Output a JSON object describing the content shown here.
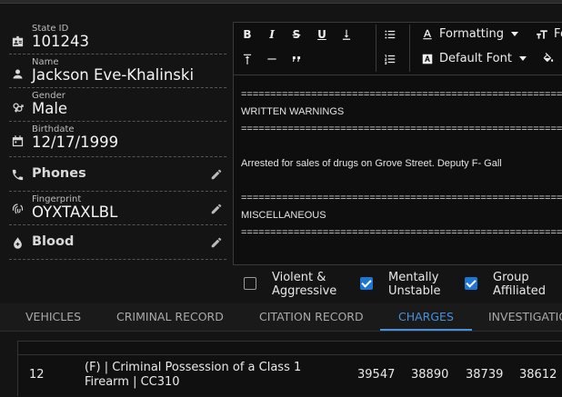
{
  "profile": {
    "state_id": {
      "label": "State ID",
      "value": "101243"
    },
    "name": {
      "label": "Name",
      "value": "Jackson Eve-Khalinski"
    },
    "gender": {
      "label": "Gender",
      "value": "Male"
    },
    "birthdate": {
      "label": "Birthdate",
      "value": "12/17/1999"
    },
    "phones": {
      "title": "Phones"
    },
    "fingerprint": {
      "label": "Fingerprint",
      "value": "OYXTAXLBL"
    },
    "blood": {
      "title": "Blood"
    }
  },
  "toolbar": {
    "bold": "B",
    "italic": "I",
    "strike": "S",
    "underline": "U",
    "formatting_label": "Formatting",
    "font_label": "Default Font",
    "cut_label": "Fo"
  },
  "document": {
    "rule": "========================================================",
    "heading1": "WRITTEN WARNINGS",
    "note": "Arrested for sales of drugs on Grove Street. Deputy F- Gall",
    "heading2": "MISCELLANEOUS"
  },
  "flags": [
    {
      "line1": "Violent &",
      "line2": "Aggressive",
      "checked": false
    },
    {
      "line1": "Mentally",
      "line2": "Unstable",
      "checked": true
    },
    {
      "line1": "Group",
      "line2": "Affiliated",
      "checked": true
    }
  ],
  "tabs": [
    "VEHICLES",
    "CRIMINAL RECORD",
    "CITATION RECORD",
    "CHARGES",
    "INVESTIGATIO"
  ],
  "active_tab": "CHARGES",
  "charges": {
    "rows": [
      {
        "count": "12",
        "description": "(F) | Criminal Possession of a Class 1 Firearm | CC310",
        "v1": "39547",
        "v2": "38890",
        "v3": "38739",
        "v4": "38612"
      }
    ]
  },
  "colors": {
    "accent": "#4a90d9",
    "checkbox": "#1f76d2",
    "background": "#141414"
  }
}
